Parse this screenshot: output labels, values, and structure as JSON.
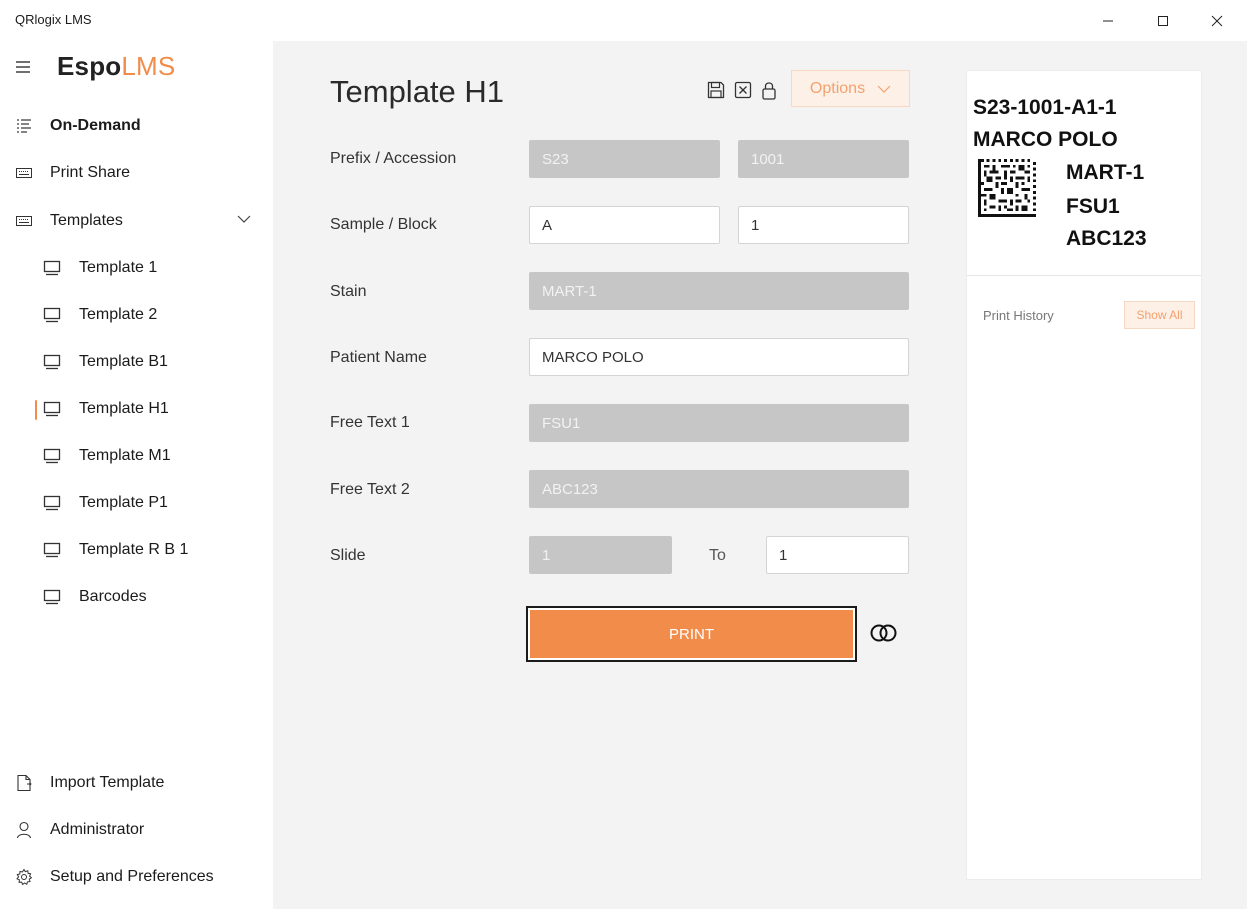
{
  "window": {
    "title": "QRlogix LMS"
  },
  "brand": {
    "part1": "Espo",
    "part2": "LMS",
    "accent_color": "#f28c4a"
  },
  "sidebar": {
    "items": [
      {
        "label": "On-Demand",
        "icon": "list-icon"
      },
      {
        "label": "Print Share",
        "icon": "keyboard-icon"
      },
      {
        "label": "Templates",
        "icon": "keyboard-icon"
      }
    ],
    "templates": [
      {
        "label": "Template 1"
      },
      {
        "label": "Template 2"
      },
      {
        "label": "Template B1"
      },
      {
        "label": "Template H1",
        "selected": true
      },
      {
        "label": "Template M1"
      },
      {
        "label": "Template P1"
      },
      {
        "label": "Template R B 1"
      },
      {
        "label": "Barcodes"
      }
    ],
    "bottom": [
      {
        "label": "Import Template",
        "icon": "document-import-icon"
      },
      {
        "label": "Administrator",
        "icon": "person-icon"
      },
      {
        "label": "Setup and Preferences",
        "icon": "gear-icon"
      }
    ]
  },
  "main": {
    "title": "Template H1",
    "options_label": "Options",
    "fields": {
      "prefix_label": "Prefix / Accession",
      "prefix_value": "S23",
      "accession_value": "1001",
      "sample_label": "Sample / Block",
      "sample_value": "A",
      "block_value": "1",
      "stain_label": "Stain",
      "stain_value": "MART-1",
      "patient_label": "Patient Name",
      "patient_value": "MARCO POLO",
      "free1_label": "Free Text 1",
      "free1_value": "FSU1",
      "free2_label": "Free Text 2",
      "free2_value": "ABC123",
      "slide_label": "Slide",
      "slide_from": "1",
      "to_label": "To",
      "slide_to": "1"
    },
    "print_label": "PRINT"
  },
  "preview": {
    "line1": "S23-1001-A1-1",
    "line2": "MARCO POLO",
    "line3": "MART-1",
    "line4": "FSU1",
    "line5": "ABC123"
  },
  "print_history": {
    "label": "Print History",
    "show_all_label": "Show All"
  }
}
